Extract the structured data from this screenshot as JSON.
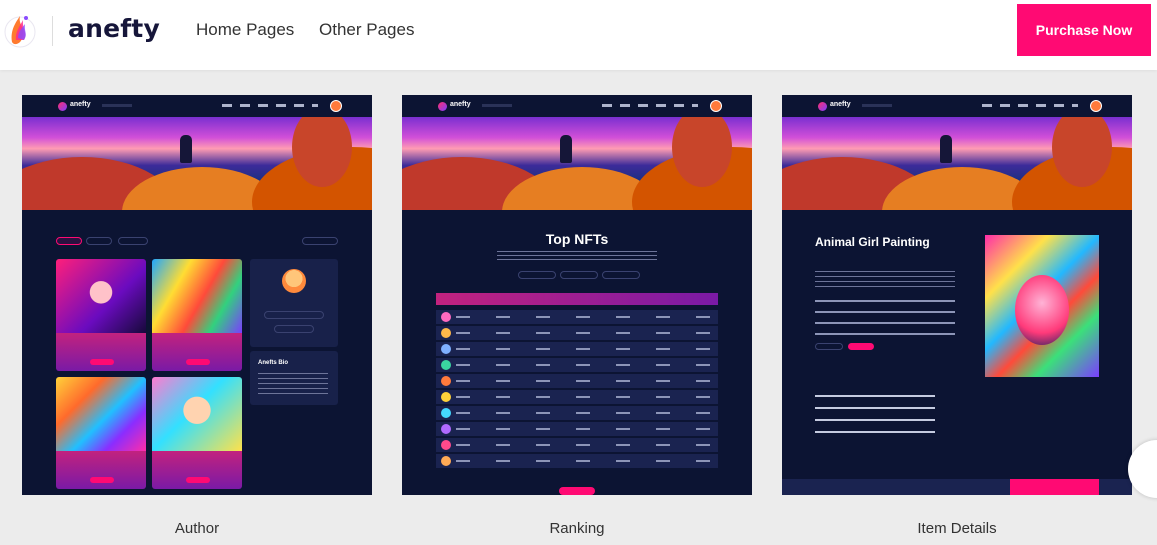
{
  "brand": {
    "name": "anefty"
  },
  "header": {
    "nav": [
      "Home Pages",
      "Other Pages"
    ],
    "purchase_label": "Purchase Now"
  },
  "previews": [
    {
      "caption": "Author",
      "label": "Anefts Bio"
    },
    {
      "caption": "Ranking",
      "title": "Top NFTs"
    },
    {
      "caption": "Item Details",
      "title": "Animal Girl Painting"
    }
  ],
  "colors": {
    "accent": "#ff0a73",
    "card_bg": "#0c1433"
  }
}
